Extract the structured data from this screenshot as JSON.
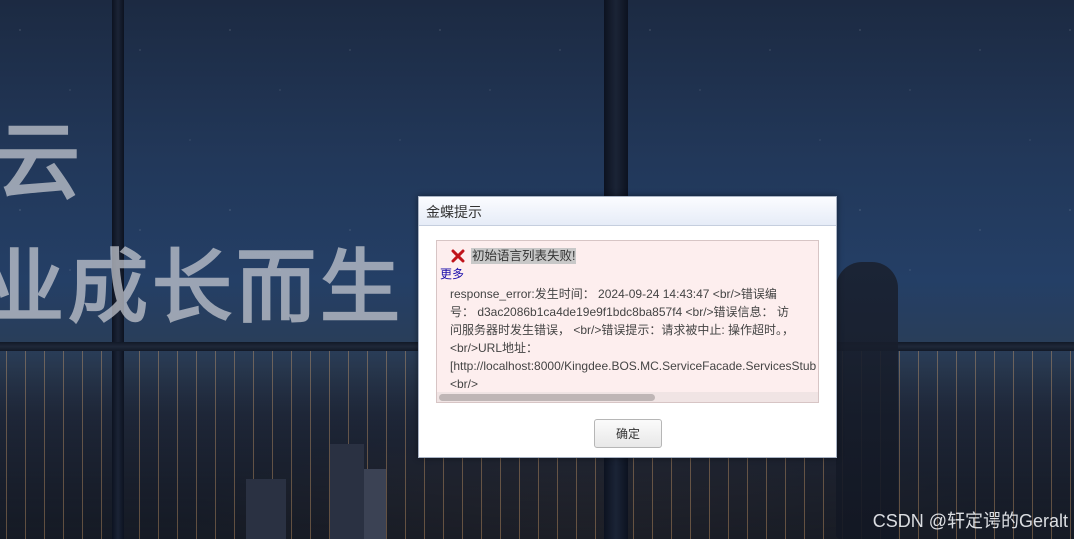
{
  "background": {
    "slogan_line1": "云",
    "slogan_line2": "业成长而生"
  },
  "dialog": {
    "title": "金蝶提示",
    "error_message": "初始语言列表失败!",
    "more_link": "更多",
    "detail_lines": [
      "response_error:发生时间： 2024-09-24 14:43:47 <br/>错误编",
      "号： d3ac2086b1ca4de19e9f1bdc8ba857f4 <br/>错误信息： 访",
      "问服务器时发生错误， <br/>错误提示：请求被中止: 操作超时。，",
      "<br/>URL地址：",
      "[http://localhost:8000/Kingdee.BOS.MC.ServiceFacade.ServicesStub",
      "<br/>"
    ],
    "ok_button": "确定",
    "error_icon": "close-x-icon",
    "error_icon_color": "#c0141b"
  },
  "watermark": "CSDN @轩定谔的Geralt"
}
